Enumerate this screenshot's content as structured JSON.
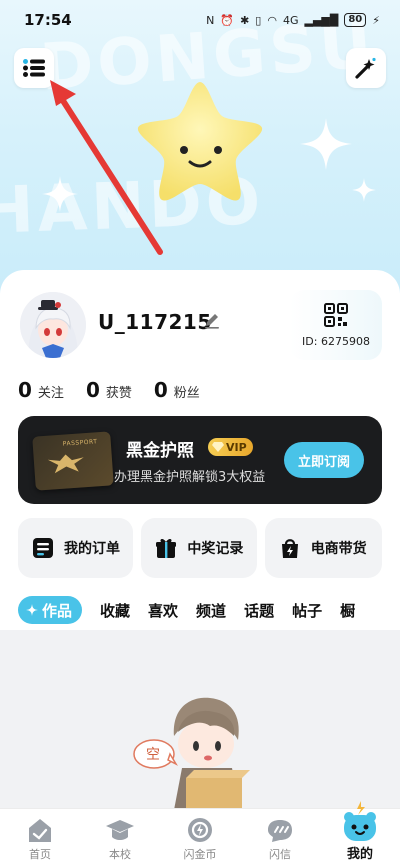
{
  "status": {
    "time": "17:54",
    "network": "4G",
    "battery": "80"
  },
  "hero": {
    "watermark_top": "DONGSU",
    "watermark_bottom": "HANDO"
  },
  "profile": {
    "username": "U_117215",
    "id_text": "ID: 6275908",
    "stats": [
      {
        "num": "0",
        "label": "关注"
      },
      {
        "num": "0",
        "label": "获赞"
      },
      {
        "num": "0",
        "label": "粉丝"
      }
    ]
  },
  "vip": {
    "title": "黑金护照",
    "badge": "VIP",
    "subtitle": "办理黑金护照解锁3大权益",
    "button": "立即订阅",
    "passport_text": "PASSPORT"
  },
  "quick": [
    {
      "label": "我的订单",
      "icon": "order-icon"
    },
    {
      "label": "中奖记录",
      "icon": "gift-icon"
    },
    {
      "label": "电商带货",
      "icon": "shopping-bag-icon"
    }
  ],
  "tabs": [
    "作品",
    "收藏",
    "喜欢",
    "频道",
    "话题",
    "帖子",
    "橱"
  ],
  "empty": {
    "bubble": "空"
  },
  "nav": [
    {
      "label": "首页",
      "icon": "home-icon"
    },
    {
      "label": "本校",
      "icon": "school-icon"
    },
    {
      "label": "闪金币",
      "icon": "coin-icon"
    },
    {
      "label": "闪信",
      "icon": "message-icon"
    },
    {
      "label": "我的",
      "icon": "mascot-icon"
    }
  ],
  "colors": {
    "accent": "#49c3e8",
    "vip_bg": "#1b1c1e",
    "gold": "#f5cd53",
    "arrow": "#e53935"
  }
}
